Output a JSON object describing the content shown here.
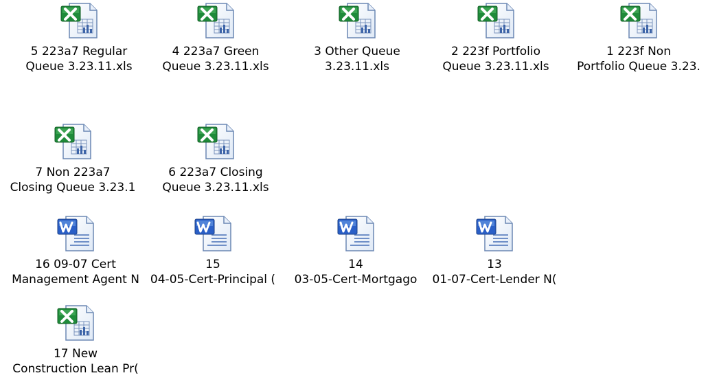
{
  "icons": {
    "excel": "excel-file-icon",
    "word": "word-file-icon"
  },
  "colors": {
    "excel_green": "#1f8b3a",
    "word_blue": "#2a5fc7",
    "page_bg": "#ffffff"
  },
  "files": [
    {
      "type": "excel",
      "line1": "5   223a7 Regular",
      "line2": "Queue 3.23.11.xls"
    },
    {
      "type": "excel",
      "line1": "4   223a7 Green",
      "line2": "Queue 3.23.11.xls"
    },
    {
      "type": "excel",
      "line1": "3    Other Queue",
      "line2": "3.23.11.xls"
    },
    {
      "type": "excel",
      "line1": "2   223f Portfolio",
      "line2": "Queue 3.23.11.xls"
    },
    {
      "type": "excel",
      "line1": "1    223f Non",
      "line2": "Portfolio Queue 3.23."
    },
    {
      "type": "excel",
      "line1": "7   Non 223a7",
      "line2": "Closing Queue 3.23.1"
    },
    {
      "type": "excel",
      "line1": "6   223a7 Closing",
      "line2": "Queue 3.23.11.xls"
    },
    {
      "type": "word",
      "line1": "16    09-07 Cert",
      "line2": "Management Agent N"
    },
    {
      "type": "word",
      "line1": "15",
      "line2": "04-05-Cert-Principal ("
    },
    {
      "type": "word",
      "line1": "14",
      "line2": "03-05-Cert-Mortgago"
    },
    {
      "type": "word",
      "line1": "13",
      "line2": "01-07-Cert-Lender N("
    },
    {
      "type": "excel",
      "line1": "17   New",
      "line2": "Construction Lean Pr("
    }
  ]
}
